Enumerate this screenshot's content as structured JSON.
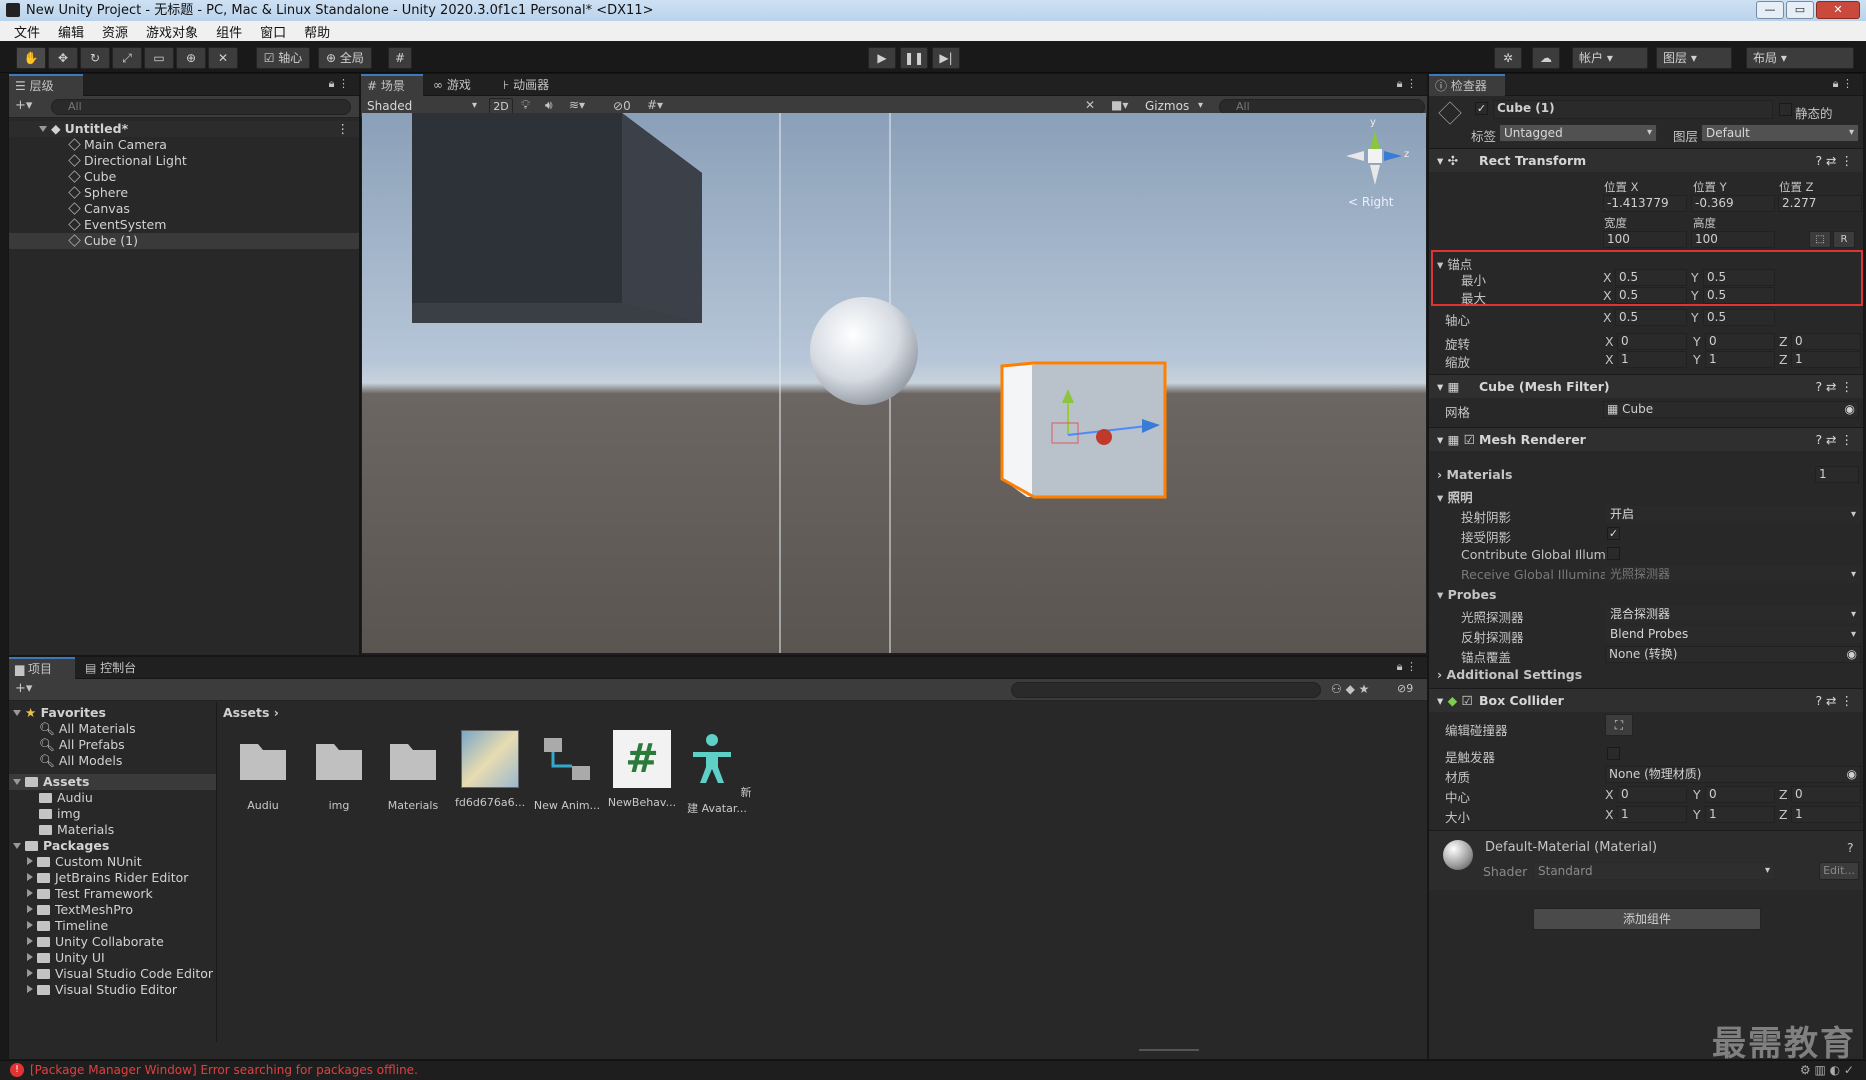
{
  "window": {
    "title": "New Unity Project - 无标题 - PC, Mac & Linux Standalone - Unity 2020.3.0f1c1 Personal* <DX11>",
    "min": "—",
    "max": "▭",
    "close": "✕"
  },
  "menu": [
    "文件",
    "编辑",
    "资源",
    "游戏对象",
    "组件",
    "窗口",
    "帮助"
  ],
  "toolbar": {
    "pivot": "轴心",
    "global": "全局",
    "account": "帐户",
    "layers": "图层",
    "layout": "布局"
  },
  "hierarchy": {
    "tab": "层级",
    "search": "All",
    "scene": "Untitled*",
    "items": [
      "Main Camera",
      "Directional Light",
      "Cube",
      "Sphere",
      "Canvas",
      "EventSystem",
      "Cube (1)"
    ]
  },
  "scene_view": {
    "tabs": [
      "场景",
      "游戏",
      "动画器"
    ],
    "shading": "Shaded",
    "mode2d": "2D",
    "hidden_count": "0",
    "gizmos": "Gizmos",
    "search": "All",
    "axis_label": "Right",
    "axis_y": "y",
    "axis_z": "z"
  },
  "project": {
    "tabs": [
      "项目",
      "控制台"
    ],
    "favorites": {
      "title": "Favorites",
      "items": [
        "All Materials",
        "All Prefabs",
        "All Models"
      ]
    },
    "assets": {
      "title": "Assets",
      "items": [
        "Audiu",
        "img",
        "Materials"
      ]
    },
    "packages": {
      "title": "Packages",
      "items": [
        "Custom NUnit",
        "JetBrains Rider Editor",
        "Test Framework",
        "TextMeshPro",
        "Timeline",
        "Unity Collaborate",
        "Unity UI",
        "Visual Studio Code Editor",
        "Visual Studio Editor"
      ]
    },
    "breadcrumb": "Assets",
    "count": "9",
    "grid": [
      "Audiu",
      "img",
      "Materials",
      "fd6d676a6...",
      "New Anim...",
      "NewBehav...",
      "新建 Avatar..."
    ]
  },
  "inspector": {
    "tab": "检查器",
    "name": "Cube (1)",
    "static": "静态的",
    "tag_label": "标签",
    "tag": "Untagged",
    "layer_label": "图层",
    "layer": "Default",
    "rect": {
      "title": "Rect Transform",
      "pos_x_label": "位置 X",
      "pos_y_label": "位置 Y",
      "pos_z_label": "位置 Z",
      "pos_x": "-1.413779",
      "pos_y": "-0.369",
      "pos_z": "2.277",
      "width_label": "宽度",
      "height_label": "高度",
      "width": "100",
      "height": "100",
      "r": "R",
      "anchors": "锚点",
      "min": "最小",
      "max": "最大",
      "min_x": "0.5",
      "min_y": "0.5",
      "max_x": "0.5",
      "max_y": "0.5",
      "pivot": "轴心",
      "pivot_x": "0.5",
      "pivot_y": "0.5",
      "rotation": "旋转",
      "rot_x": "0",
      "rot_y": "0",
      "rot_z": "0",
      "scale": "缩放",
      "sc_x": "1",
      "sc_y": "1",
      "sc_z": "1"
    },
    "mesh_filter": {
      "title": "Cube (Mesh Filter)",
      "mesh_label": "网格",
      "mesh": "Cube"
    },
    "renderer": {
      "title": "Mesh Renderer",
      "materials": "Materials",
      "mat_count": "1",
      "lighting": "照明",
      "cast": "投射阴影",
      "cast_val": "开启",
      "receive": "接受阴影",
      "gi": "Contribute Global Illumir",
      "rgi": "Receive Global Illuminati",
      "rgi_val": "光照探测器",
      "probes": "Probes",
      "light_probes": "光照探测器",
      "light_probes_val": "混合探测器",
      "refl": "反射探测器",
      "refl_val": "Blend Probes",
      "anchor_over": "锚点覆盖",
      "anchor_over_val": "None (转换)",
      "additional": "Additional Settings"
    },
    "collider": {
      "title": "Box Collider",
      "edit": "编辑碰撞器",
      "trigger": "是触发器",
      "material": "材质",
      "material_val": "None (物理材质)",
      "center": "中心",
      "c_x": "0",
      "c_y": "0",
      "c_z": "0",
      "size": "大小",
      "s_x": "1",
      "s_y": "1",
      "s_z": "1"
    },
    "material": {
      "name": "Default-Material (Material)",
      "shader_label": "Shader",
      "shader": "Standard",
      "edit": "Edit..."
    },
    "add_component": "添加组件"
  },
  "status": {
    "error": "[Package Manager Window] Error searching for packages offline."
  },
  "watermark": "最需教育",
  "colors": {
    "accent": "#3a79bb",
    "highlight": "#e03333",
    "selection": "#ff8000"
  }
}
